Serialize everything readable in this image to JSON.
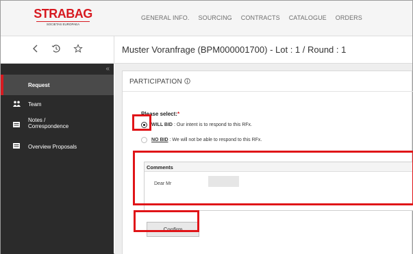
{
  "brand": {
    "name": "STRABAG",
    "tagline": "SOCIETAS EUROPAEA",
    "red": "#d71920"
  },
  "nav": {
    "items": [
      "GENERAL INFO.",
      "SOURCING",
      "CONTRACTS",
      "CATALOGUE",
      "ORDERS"
    ]
  },
  "subheader": {
    "icons": [
      "back-icon",
      "history-icon",
      "star-icon"
    ],
    "title": "Muster Voranfrage (BPM000001700) - Lot : 1 / Round : 1"
  },
  "sidebar": {
    "collapse_glyph": "«",
    "items": [
      {
        "label": "Request",
        "icon": "red-marker",
        "active": true
      },
      {
        "label": "Team",
        "icon": "team-icon",
        "active": false
      },
      {
        "label": "Notes / Correspondence",
        "icon": "notes-icon",
        "active": false
      },
      {
        "label": "Overview Proposals",
        "icon": "overview-icon",
        "active": false
      }
    ]
  },
  "participation": {
    "title": "PARTICIPATION",
    "info_icon": "info-icon",
    "select_label": "Please select:",
    "required_mark": "*",
    "options": [
      {
        "key": "WILL BID",
        "text": ": Our intent is to respond to this RFx.",
        "checked": true
      },
      {
        "key": "NO BID",
        "text": ": We will not be able to respond to this RFx.",
        "checked": false
      }
    ],
    "comments_label": "Comments",
    "comments_value": "Dear Mr",
    "confirm_label": "Confirm"
  },
  "annotation_color": "#e01418"
}
